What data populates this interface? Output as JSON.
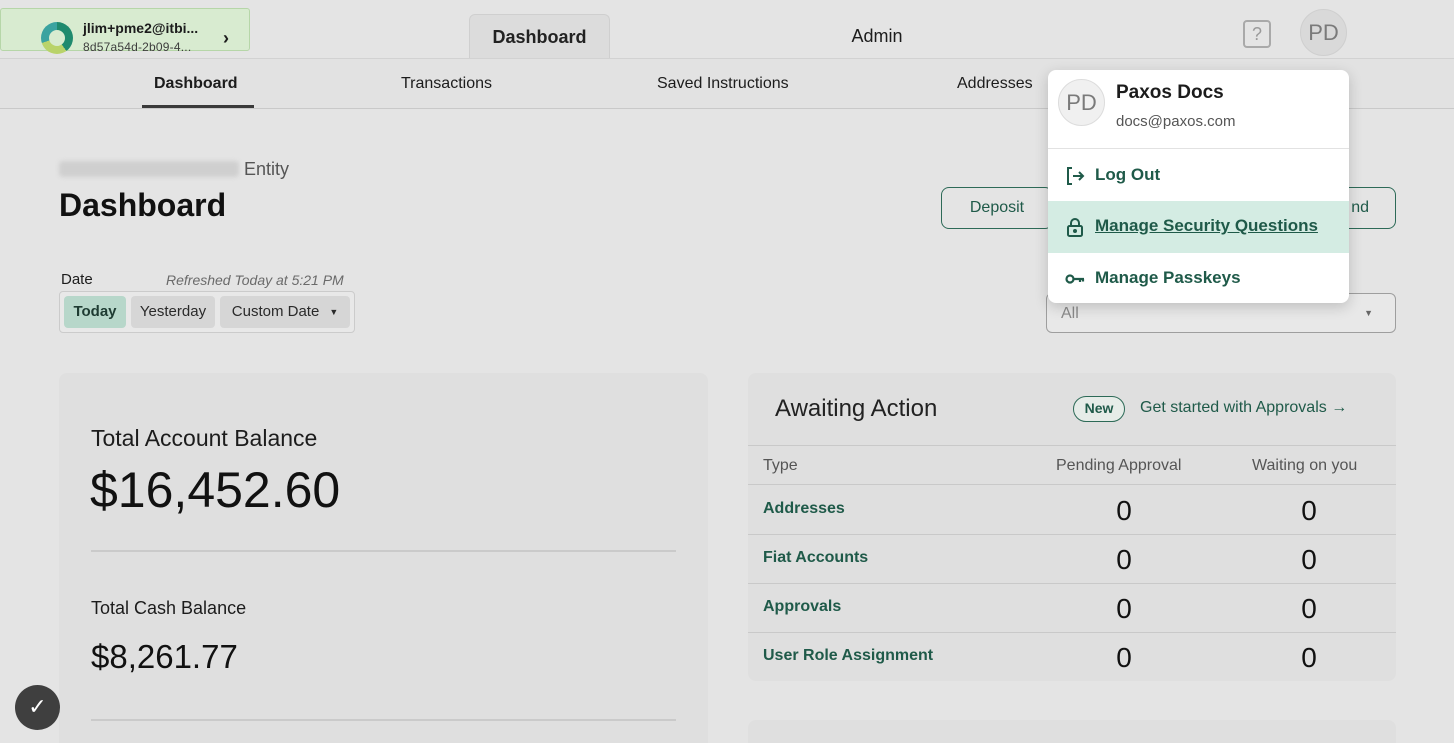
{
  "header": {
    "entity": {
      "name": "jlim+pme2@itbi...",
      "id": "8d57a54d-2b09-4..."
    },
    "tabs": [
      {
        "label": "Dashboard",
        "active": true
      },
      {
        "label": "Admin",
        "active": false
      }
    ],
    "help_icon": "question-icon",
    "avatar_initials": "PD"
  },
  "subnav": {
    "items": [
      {
        "label": "Dashboard",
        "active": true
      },
      {
        "label": "Transactions",
        "active": false
      },
      {
        "label": "Saved Instructions",
        "active": false
      },
      {
        "label": "Addresses",
        "active": false
      }
    ]
  },
  "page": {
    "entity_suffix": "Entity",
    "title": "Dashboard",
    "actions": {
      "deposit": "Deposit",
      "send": "nd"
    }
  },
  "date_filter": {
    "label": "Date",
    "refreshed": "Refreshed Today at 5:21 PM",
    "options": [
      "Today",
      "Yesterday",
      "Custom Date"
    ],
    "selected": "Today"
  },
  "account_select": {
    "value": "All"
  },
  "balances": {
    "total_account_label": "Total Account Balance",
    "total_account_value": "$16,452.60",
    "total_cash_label": "Total Cash Balance",
    "total_cash_value": "$8,261.77"
  },
  "awaiting": {
    "title": "Awaiting Action",
    "badge": "New",
    "link": "Get started with Approvals →",
    "columns": [
      "Type",
      "Pending Approval",
      "Waiting on you"
    ],
    "rows": [
      {
        "type": "Addresses",
        "pending": "0",
        "waiting": "0"
      },
      {
        "type": "Fiat Accounts",
        "pending": "0",
        "waiting": "0"
      },
      {
        "type": "Approvals",
        "pending": "0",
        "waiting": "0"
      },
      {
        "type": "User Role Assignment",
        "pending": "0",
        "waiting": "0"
      }
    ]
  },
  "user_menu": {
    "initials": "PD",
    "name": "Paxos Docs",
    "email": "docs@paxos.com",
    "items": [
      {
        "label": "Log Out",
        "icon": "logout-icon"
      },
      {
        "label": "Manage Security Questions",
        "icon": "lock-icon",
        "hovered": true
      },
      {
        "label": "Manage Passkeys",
        "icon": "key-icon"
      }
    ]
  },
  "colors": {
    "brand_green": "#1f5a49",
    "hover_bg": "#d4ece3",
    "active_chip": "#b7d7ca"
  }
}
